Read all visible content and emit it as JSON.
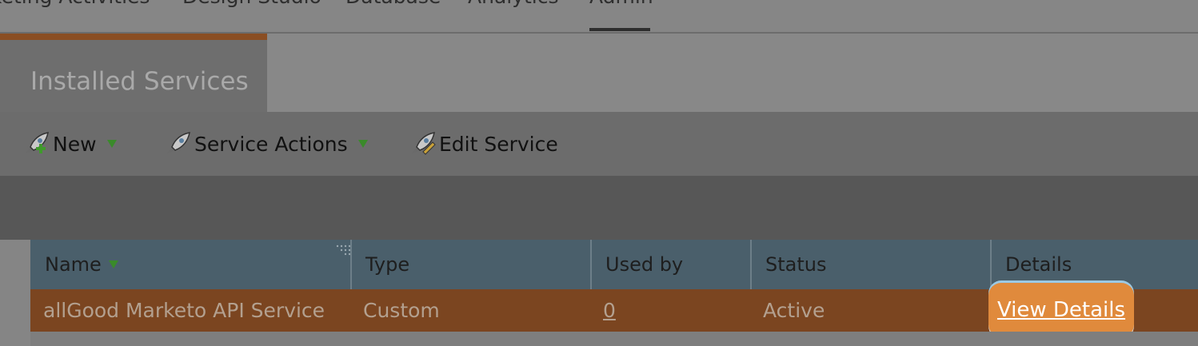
{
  "top_nav": {
    "tabs": [
      "keting Activities",
      "Design Studio",
      "Database",
      "Analytics",
      "Admin"
    ],
    "active": "Admin"
  },
  "panel": {
    "title": "Installed Services"
  },
  "toolbar": {
    "new_label": "New",
    "service_actions_label": "Service Actions",
    "edit_service_label": "Edit Service"
  },
  "table": {
    "columns": [
      "Name",
      "Type",
      "Used by",
      "Status",
      "Details"
    ],
    "rows": [
      {
        "name": "allGood Marketo API Service",
        "type": "Custom",
        "used_by": "0",
        "status": "Active",
        "details": "View Details"
      }
    ]
  },
  "colors": {
    "accent": "#e08a3c",
    "header_bg": "#4a5f6b",
    "selected_row": "#7b4520"
  }
}
